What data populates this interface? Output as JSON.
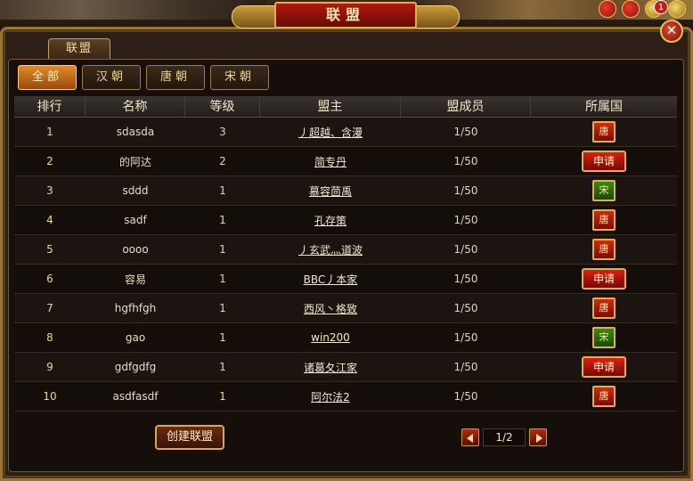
{
  "window": {
    "title": "联盟",
    "notification_count": "1",
    "close_label": "✕"
  },
  "main_tab": {
    "label": "联盟"
  },
  "filters": [
    {
      "label": "全部",
      "active": true
    },
    {
      "label": "汉朝",
      "active": false
    },
    {
      "label": "唐朝",
      "active": false
    },
    {
      "label": "宋朝",
      "active": false
    }
  ],
  "table": {
    "headers": [
      "排行",
      "名称",
      "等级",
      "盟主",
      "盟成员",
      "所属国"
    ],
    "rows": [
      {
        "rank": "1",
        "name": "sdasda",
        "level": "3",
        "leader": "丿超越、含漫",
        "members": "1/50",
        "nation": "tang",
        "nation_label": "唐"
      },
      {
        "rank": "2",
        "name": "的阿达",
        "level": "2",
        "leader": "简专丹",
        "members": "1/50",
        "nation": "apply",
        "nation_label": "申请"
      },
      {
        "rank": "3",
        "name": "sddd",
        "level": "1",
        "leader": "慕容茴禹",
        "members": "1/50",
        "nation": "song",
        "nation_label": "宋"
      },
      {
        "rank": "4",
        "name": "sadf",
        "level": "1",
        "leader": "孔存策",
        "members": "1/50",
        "nation": "tang",
        "nation_label": "唐"
      },
      {
        "rank": "5",
        "name": "oooo",
        "level": "1",
        "leader": "丿玄武灬道波",
        "members": "1/50",
        "nation": "tang",
        "nation_label": "唐"
      },
      {
        "rank": "6",
        "name": "容易",
        "level": "1",
        "leader": "BBC丿本家",
        "members": "1/50",
        "nation": "apply",
        "nation_label": "申请"
      },
      {
        "rank": "7",
        "name": "hgfhfgh",
        "level": "1",
        "leader": "西风丶格致",
        "members": "1/50",
        "nation": "tang",
        "nation_label": "唐"
      },
      {
        "rank": "8",
        "name": "gao",
        "level": "1",
        "leader": "win200",
        "members": "1/50",
        "nation": "song",
        "nation_label": "宋"
      },
      {
        "rank": "9",
        "name": "gdfgdfg",
        "level": "1",
        "leader": "诸葛夂江家",
        "members": "1/50",
        "nation": "apply",
        "nation_label": "申请"
      },
      {
        "rank": "10",
        "name": "asdfasdf",
        "level": "1",
        "leader": "阿尔法2",
        "members": "1/50",
        "nation": "tang",
        "nation_label": "唐"
      }
    ]
  },
  "footer": {
    "create_label": "创建联盟",
    "page_indicator": "1/2"
  },
  "colors": {
    "frame_gold": "#9a7636",
    "tang_red": "#d02a12",
    "song_green": "#3a8a1a",
    "active_tab": "#e08a2a"
  }
}
